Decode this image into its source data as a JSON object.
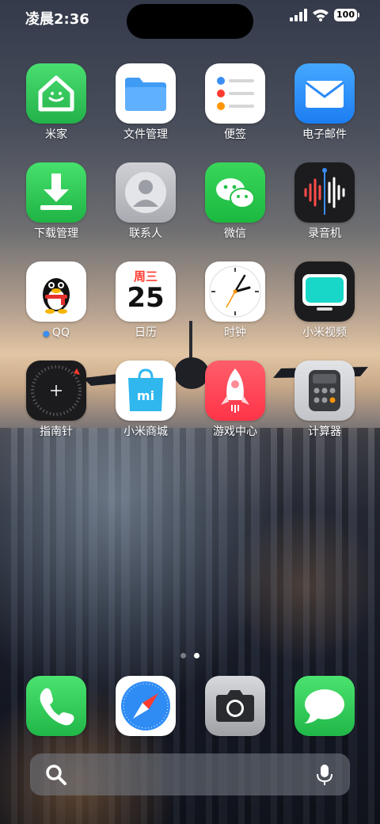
{
  "status_bar": {
    "time": "凌晨2:36",
    "battery": "100"
  },
  "apps": [
    {
      "label": "米家"
    },
    {
      "label": "文件管理"
    },
    {
      "label": "便签"
    },
    {
      "label": "电子邮件"
    },
    {
      "label": "下载管理"
    },
    {
      "label": "联系人"
    },
    {
      "label": "微信"
    },
    {
      "label": "录音机"
    },
    {
      "label": "QQ"
    },
    {
      "label": "日历",
      "weekday": "周三",
      "day": "25"
    },
    {
      "label": "时钟"
    },
    {
      "label": "小米视频"
    },
    {
      "label": "指南针"
    },
    {
      "label": "小米商城"
    },
    {
      "label": "游戏中心"
    },
    {
      "label": "计算器"
    }
  ],
  "dock": [
    {
      "icon": "phone-icon"
    },
    {
      "icon": "safari-icon"
    },
    {
      "icon": "camera-icon"
    },
    {
      "icon": "messages-icon"
    }
  ],
  "page_indicator": {
    "pages": 2,
    "current": 2
  },
  "colors": {
    "mijia": "#34c759",
    "files": "#3a9af3",
    "mail": "#2d8cf7",
    "wechat": "#2dc84d",
    "game": "#ff4b5c"
  }
}
